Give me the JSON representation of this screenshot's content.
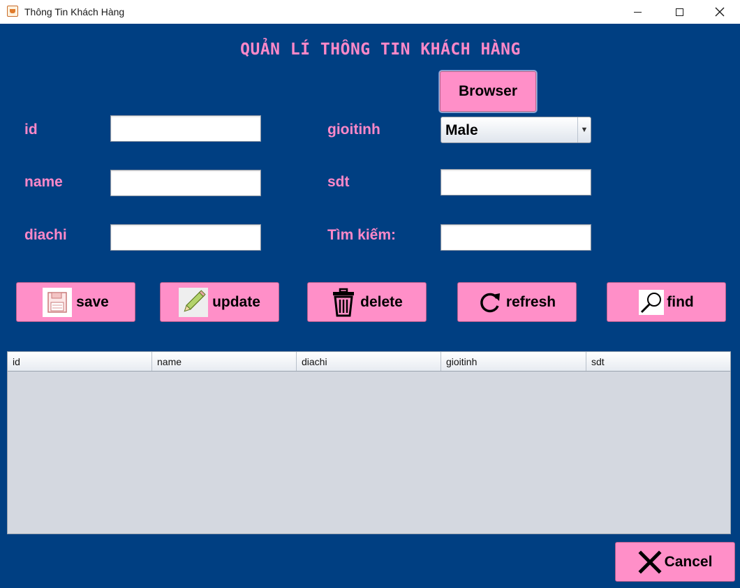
{
  "window": {
    "title": "Thông Tin Khách Hàng"
  },
  "app_title": "QUẢN LÍ THÔNG TIN KHÁCH HÀNG",
  "form": {
    "id_label": "id",
    "name_label": "name",
    "diachi_label": "diachi",
    "gioitinh_label": "gioitinh",
    "sdt_label": "sdt",
    "search_label": "Tìm kiếm:",
    "gioitinh_value": "Male",
    "id_value": "",
    "name_value": "",
    "diachi_value": "",
    "sdt_value": "",
    "search_value": ""
  },
  "buttons": {
    "browser": "Browser",
    "save": "save",
    "update": "update",
    "delete": "delete",
    "refresh": "refresh",
    "find": "find",
    "cancel": "Cancel"
  },
  "table": {
    "columns": [
      "id",
      "name",
      "diachi",
      "gioitinh",
      "sdt"
    ],
    "rows": []
  },
  "icons": {
    "app": "java-cup-icon",
    "save": "floppy-disk-icon",
    "update": "pencil-icon",
    "delete": "trash-icon",
    "refresh": "refresh-icon",
    "find": "magnifier-icon",
    "cancel": "x-icon"
  },
  "colors": {
    "background": "#003f82",
    "accent": "#ff88c8",
    "button": "#ff8fc8",
    "table_background": "#d4d8e0"
  }
}
